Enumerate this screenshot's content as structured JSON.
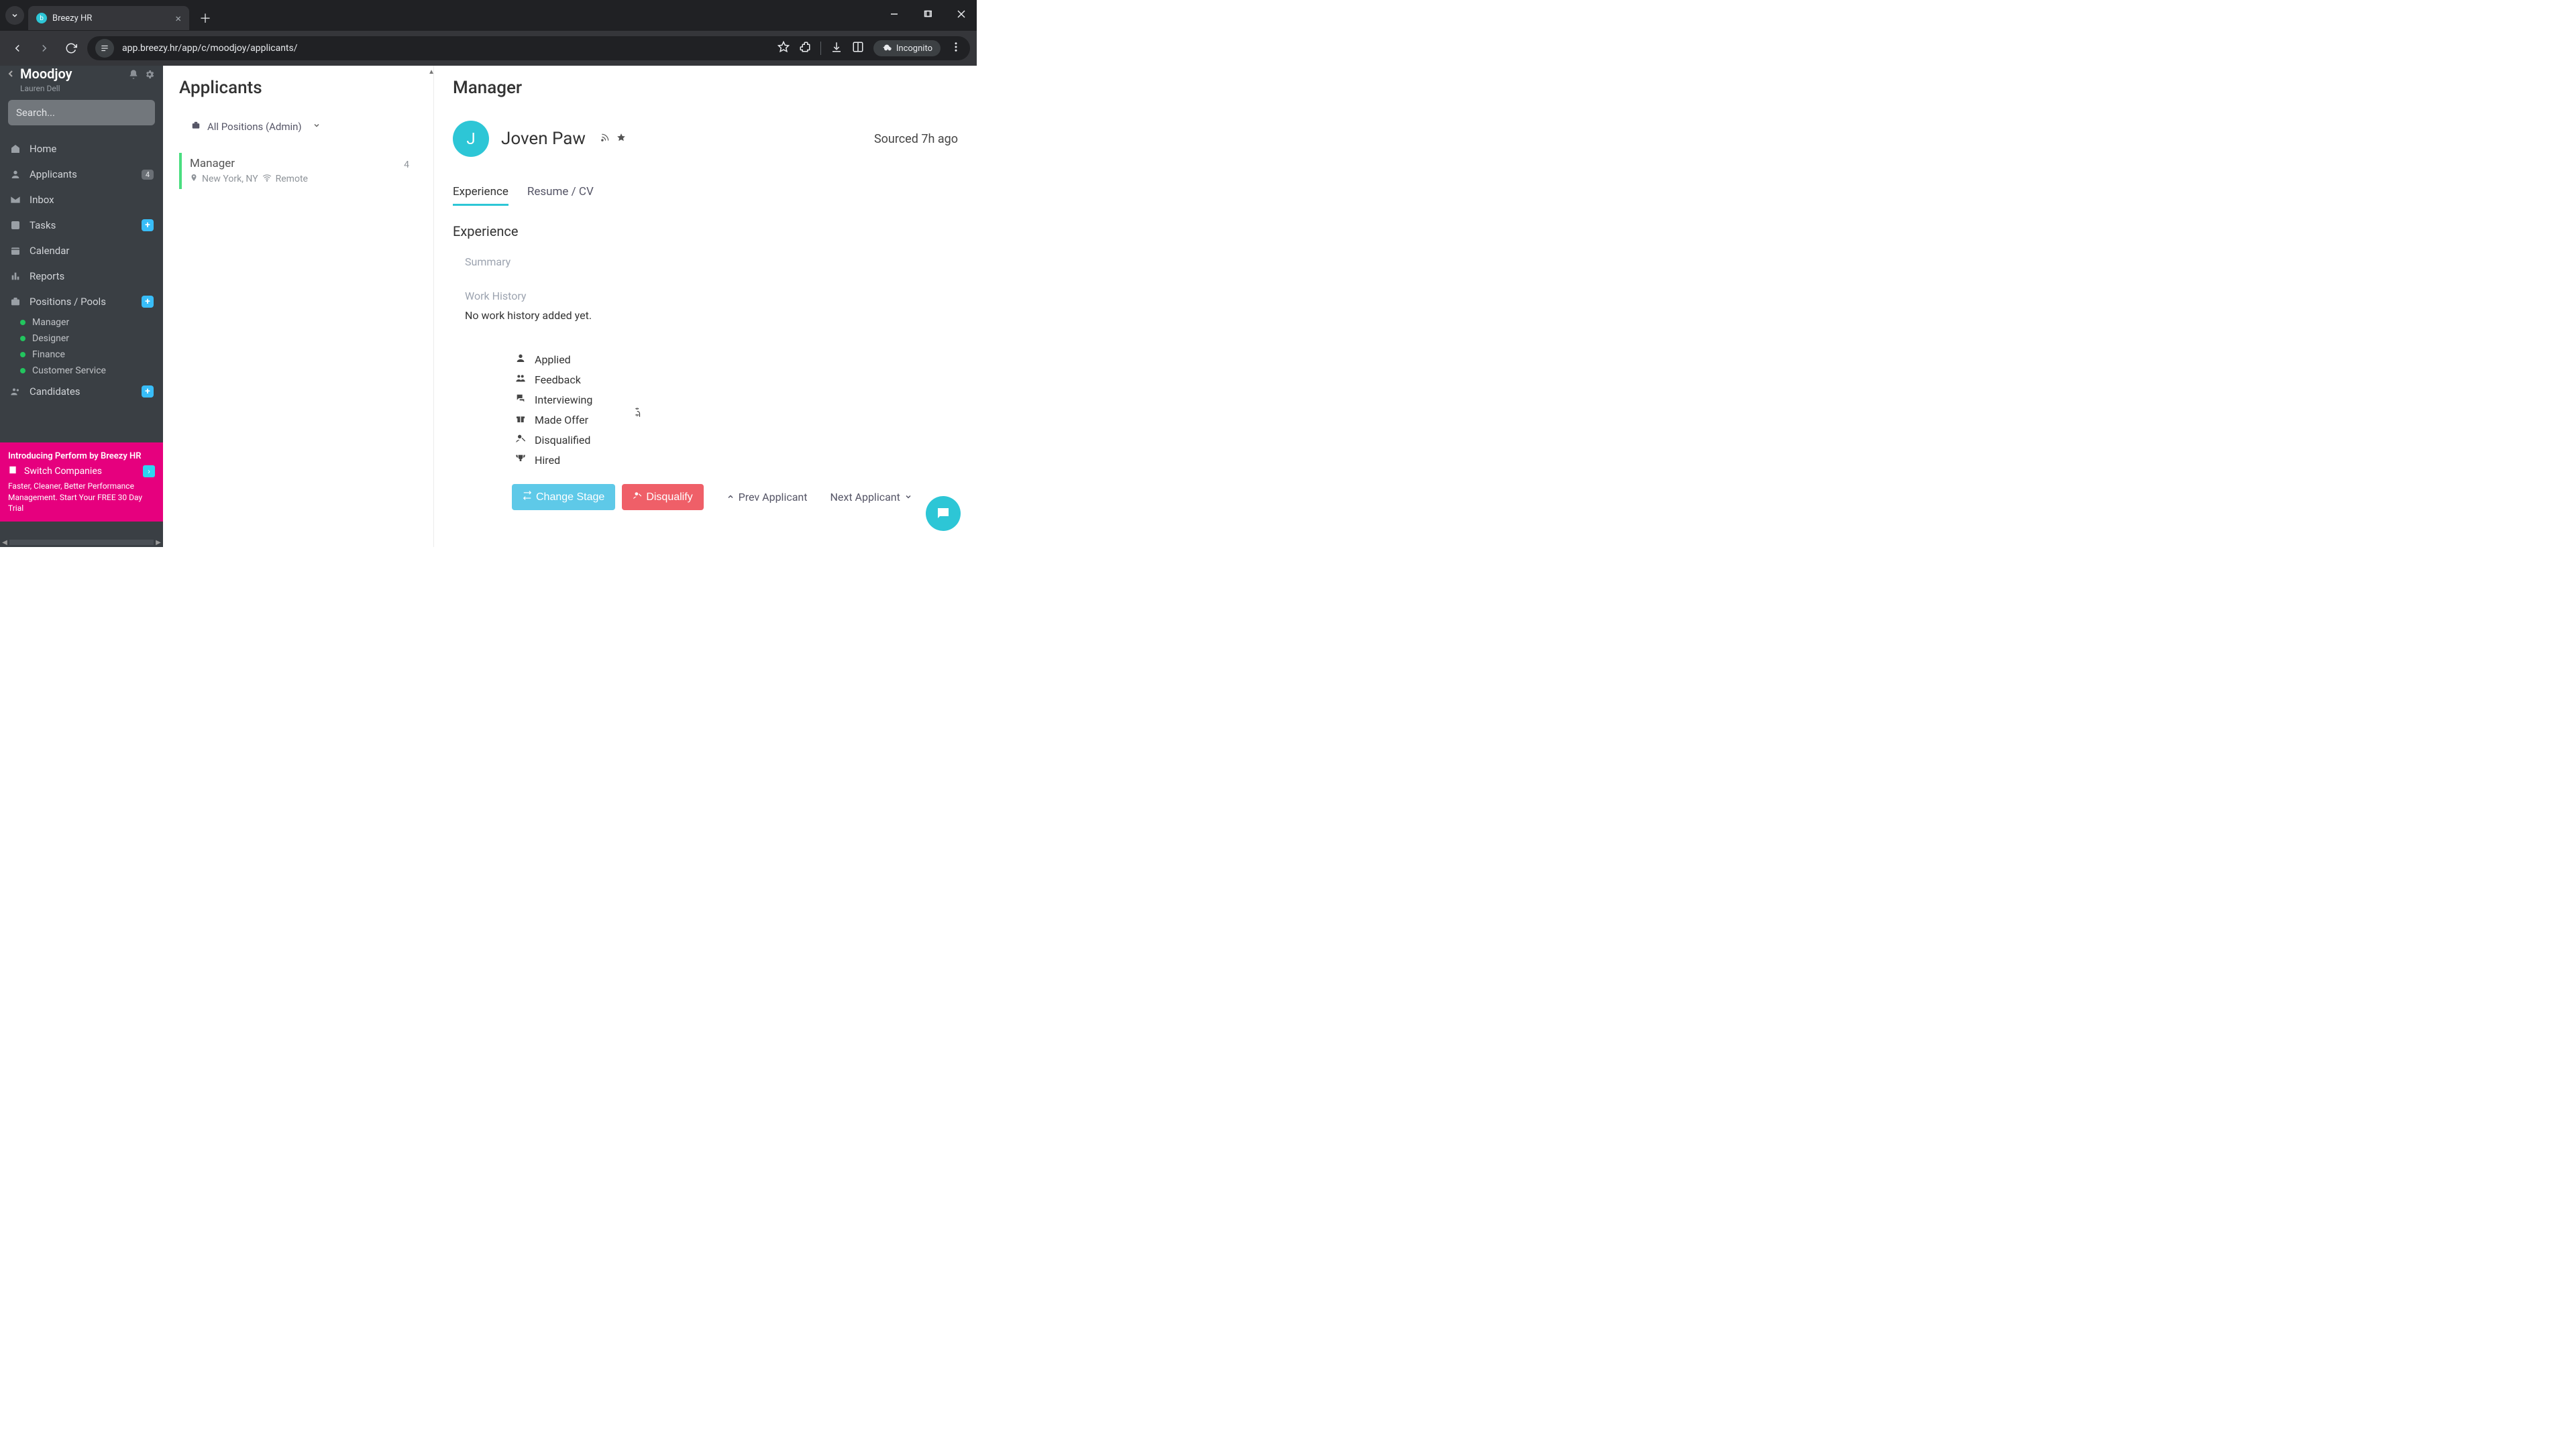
{
  "browser": {
    "tab_title": "Breezy HR",
    "url": "app.breezy.hr/app/c/moodjoy/applicants/",
    "incognito_label": "Incognito"
  },
  "company": {
    "name": "Moodjoy",
    "user": "Lauren Dell"
  },
  "search": {
    "placeholder": "Search..."
  },
  "nav": {
    "home": "Home",
    "applicants": "Applicants",
    "applicants_badge": "4",
    "inbox": "Inbox",
    "tasks": "Tasks",
    "calendar": "Calendar",
    "reports": "Reports",
    "positions": "Positions / Pools",
    "positions_children": [
      "Manager",
      "Designer",
      "Finance",
      "Customer Service"
    ],
    "candidates": "Candidates"
  },
  "promo": {
    "title": "Introducing Perform by Breezy HR",
    "switch": "Switch Companies",
    "body": "Faster, Cleaner, Better Performance Management. Start Your FREE 30 Day Trial"
  },
  "mid": {
    "heading": "Applicants",
    "filter": "All Positions (Admin)",
    "position": {
      "title": "Manager",
      "location": "New York, NY",
      "remote": "Remote",
      "count": "4"
    }
  },
  "detail": {
    "heading": "Manager",
    "avatar_initial": "J",
    "applicant_name": "Joven Paw",
    "sourced": "Sourced 7h ago",
    "tabs": {
      "experience": "Experience",
      "resume": "Resume / CV"
    },
    "section": "Experience",
    "summary_label": "Summary",
    "workhistory_label": "Work History",
    "workhistory_empty": "No work history added yet.",
    "stages": {
      "applied": "Applied",
      "feedback": "Feedback",
      "interviewing": "Interviewing",
      "made_offer": "Made Offer",
      "disqualified": "Disqualified",
      "hired": "Hired"
    },
    "buttons": {
      "change_stage": "Change Stage",
      "disqualify": "Disqualify",
      "prev": "Prev Applicant",
      "next": "Next Applicant"
    }
  }
}
